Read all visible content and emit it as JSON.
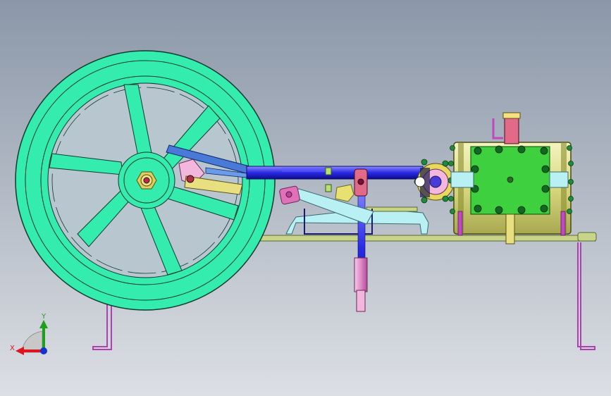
{
  "viewport": {
    "background_top": "#8b97a8",
    "background_bottom": "#dcdfe4"
  },
  "triad": {
    "x_label": "X",
    "y_label": "Y",
    "x_color": "#e0141e",
    "y_color": "#1ea01e",
    "z_color": "#1432d2"
  },
  "colors": {
    "flywheel": "#33ecad",
    "flywheel_edge": "#0f3a2c",
    "base_plate": "#c7d48a",
    "support": "#c048c0",
    "cylinder_body": "#e0e08a",
    "cylinder_face": "#3fd03f",
    "bolt": "#0d6a1e",
    "piston_rod": "#1a1ae6",
    "connecting_rod": "#2a58c8",
    "pink_part": "#f3b6dd",
    "cyan_part": "#9fe8ee",
    "red_part": "#e06a88",
    "yellow_part": "#d8d85a"
  }
}
